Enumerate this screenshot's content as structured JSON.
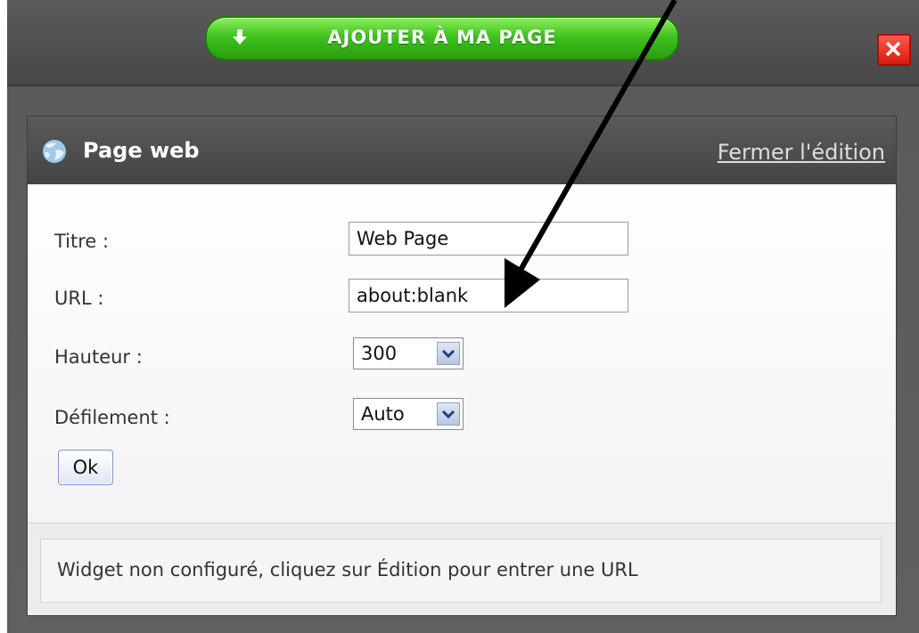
{
  "toolbar": {
    "add_button_label": "AJOUTER À MA PAGE",
    "add_icon": "arrow-down-icon",
    "close_icon": "close-icon"
  },
  "widget": {
    "title": "Page web",
    "icon": "globe-icon",
    "close_edit_link": "Fermer l'édition"
  },
  "form": {
    "title": {
      "label": "Titre :",
      "value": "Web Page"
    },
    "url": {
      "label": "URL :",
      "value": "about:blank"
    },
    "height": {
      "label": "Hauteur :",
      "value": "300"
    },
    "scrolling": {
      "label": "Défilement :",
      "value": "Auto"
    },
    "ok_label": "Ok"
  },
  "status": {
    "message": "Widget non configuré, cliquez sur Édition pour entrer une URL"
  },
  "colors": {
    "accent_green": "#3fc21f",
    "close_red": "#d41a0e",
    "header_dark": "#4e4e4e"
  }
}
